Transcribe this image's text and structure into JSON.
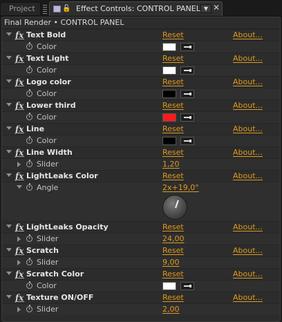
{
  "tabs": {
    "project": "Project",
    "effect_controls": "Effect Controls: CONTROL PANEL"
  },
  "breadcrumb": "Final Render • CONTROL PANEL",
  "labels": {
    "reset": "Reset",
    "about": "About..."
  },
  "effects": [
    {
      "name": "Text Bold",
      "prop": "Color",
      "type": "color",
      "color": "#ffffff"
    },
    {
      "name": "Text Light",
      "prop": "Color",
      "type": "color",
      "color": "#ffffff"
    },
    {
      "name": "Logo color",
      "prop": "Color",
      "type": "color",
      "color": "#000000"
    },
    {
      "name": "Lower third",
      "prop": "Color",
      "type": "color",
      "color": "#ff1a1a"
    },
    {
      "name": "Line",
      "prop": "Color",
      "type": "color",
      "color": "#000000"
    },
    {
      "name": "Line Width",
      "prop": "Slider",
      "type": "slider",
      "value": "1,20"
    },
    {
      "name": "LightLeaks Color",
      "prop": "Angle",
      "type": "angle",
      "value": "2x+19,0°"
    },
    {
      "name": "LightLeaks Opacity",
      "prop": "Slider",
      "type": "slider",
      "value": "24,00"
    },
    {
      "name": "Scratch",
      "prop": "Slider",
      "type": "slider",
      "value": "9,00"
    },
    {
      "name": "Scratch Color",
      "prop": "Color",
      "type": "color",
      "color": "#ffffff"
    },
    {
      "name": "Texture ON/OFF",
      "prop": "Slider",
      "type": "slider",
      "value": "2,00"
    }
  ],
  "icons": {
    "panel_lock": "lock-icon",
    "panel_menu": "dropdown-icon",
    "close": "close-icon",
    "stopwatch": "stopwatch-icon",
    "fx": "fx-icon",
    "eyedropper": "eyedropper-icon"
  },
  "colors": {
    "accent": "#e09a1f",
    "panel_bg": "#2c2c2c"
  }
}
